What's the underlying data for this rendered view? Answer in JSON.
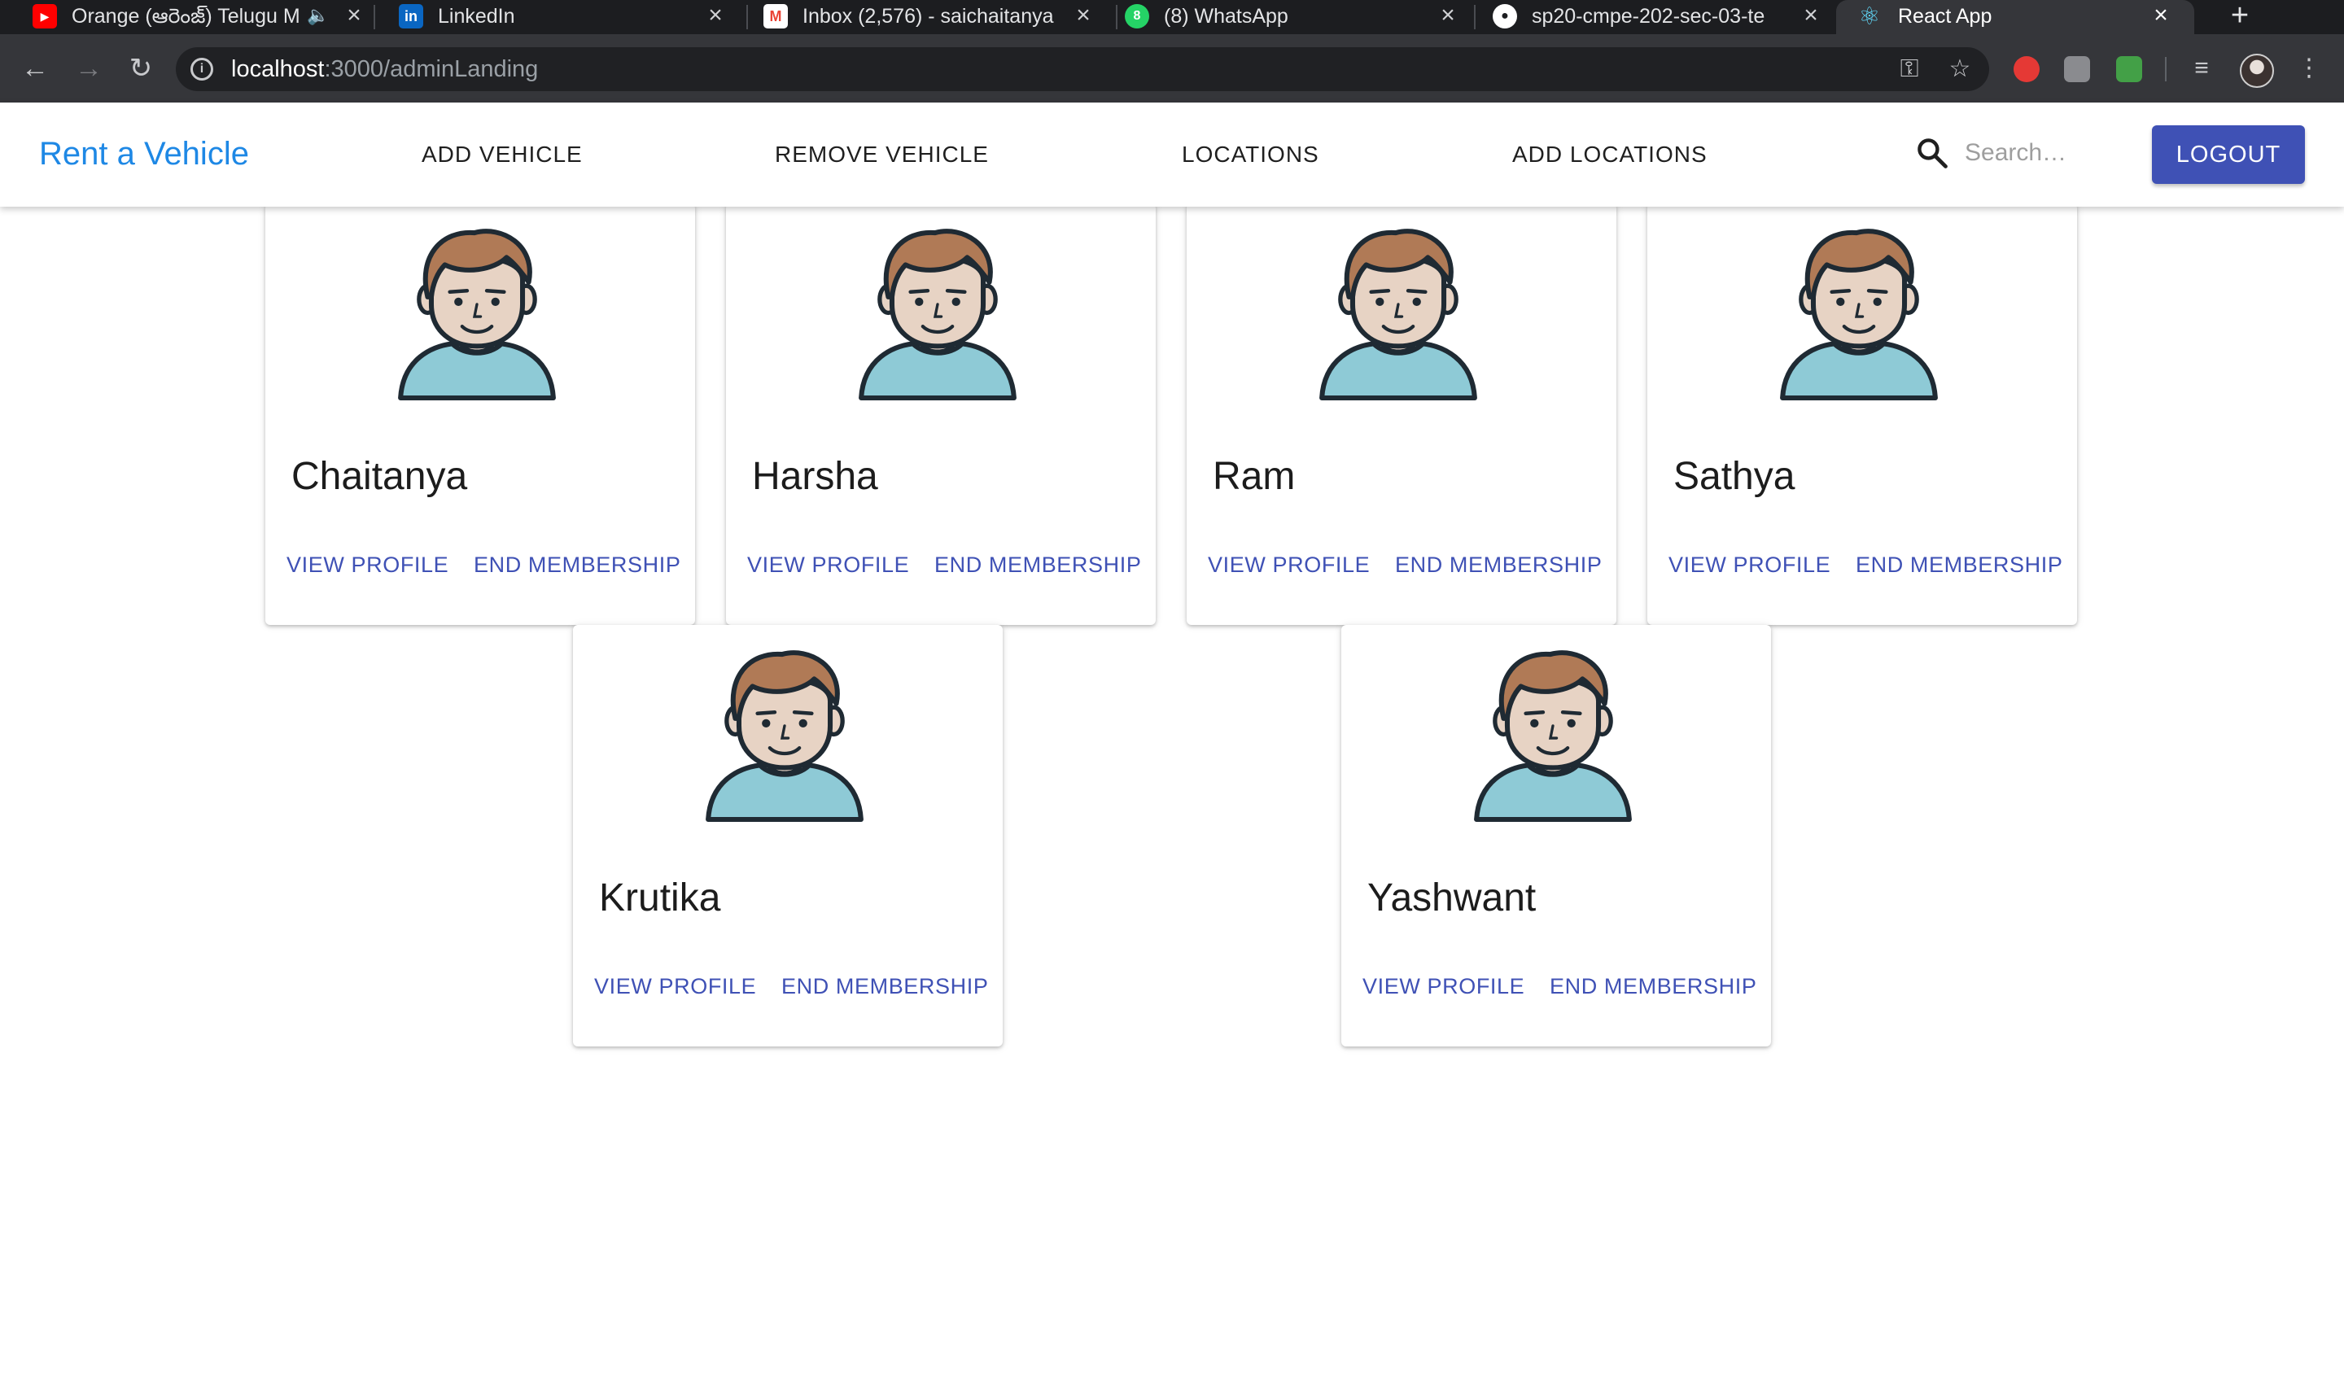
{
  "browser": {
    "tabs": [
      {
        "title": "Orange (ఆరెంజ్) Telugu M",
        "favicon": "youtube-icon",
        "color": "#ff0000",
        "muted": true
      },
      {
        "title": "LinkedIn",
        "favicon": "linkedin-icon",
        "color": "#0a66c2"
      },
      {
        "title": "Inbox (2,576) - saichaitanya",
        "favicon": "gmail-icon",
        "color": "#ea4335"
      },
      {
        "title": "(8) WhatsApp",
        "favicon": "whatsapp-icon",
        "color": "#25d366"
      },
      {
        "title": "sp20-cmpe-202-sec-03-te",
        "favicon": "github-icon",
        "color": "#ffffff"
      },
      {
        "title": "React App",
        "favicon": "react-icon",
        "color": "#61dafb",
        "active": true
      }
    ],
    "address": {
      "host": "localhost",
      "path": ":3000/adminLanding"
    }
  },
  "appbar": {
    "brand": "Rent a Vehicle",
    "nav": [
      "ADD VEHICLE",
      "REMOVE VEHICLE",
      "LOCATIONS",
      "ADD LOCATIONS"
    ],
    "search_placeholder": "Search…",
    "logout_label": "LOGOUT",
    "accent_color": "#3f51b5",
    "brand_color": "#1e88e5"
  },
  "members": [
    {
      "name": "Chaitanya",
      "view_label": "VIEW PROFILE",
      "end_label": "END MEMBERSHIP"
    },
    {
      "name": "Harsha",
      "view_label": "VIEW PROFILE",
      "end_label": "END MEMBERSHIP"
    },
    {
      "name": "Ram",
      "view_label": "VIEW PROFILE",
      "end_label": "END MEMBERSHIP"
    },
    {
      "name": "Sathya",
      "view_label": "VIEW PROFILE",
      "end_label": "END MEMBERSHIP"
    },
    {
      "name": "Krutika",
      "view_label": "VIEW PROFILE",
      "end_label": "END MEMBERSHIP"
    },
    {
      "name": "Yashwant",
      "view_label": "VIEW PROFILE",
      "end_label": "END MEMBERSHIP"
    }
  ]
}
